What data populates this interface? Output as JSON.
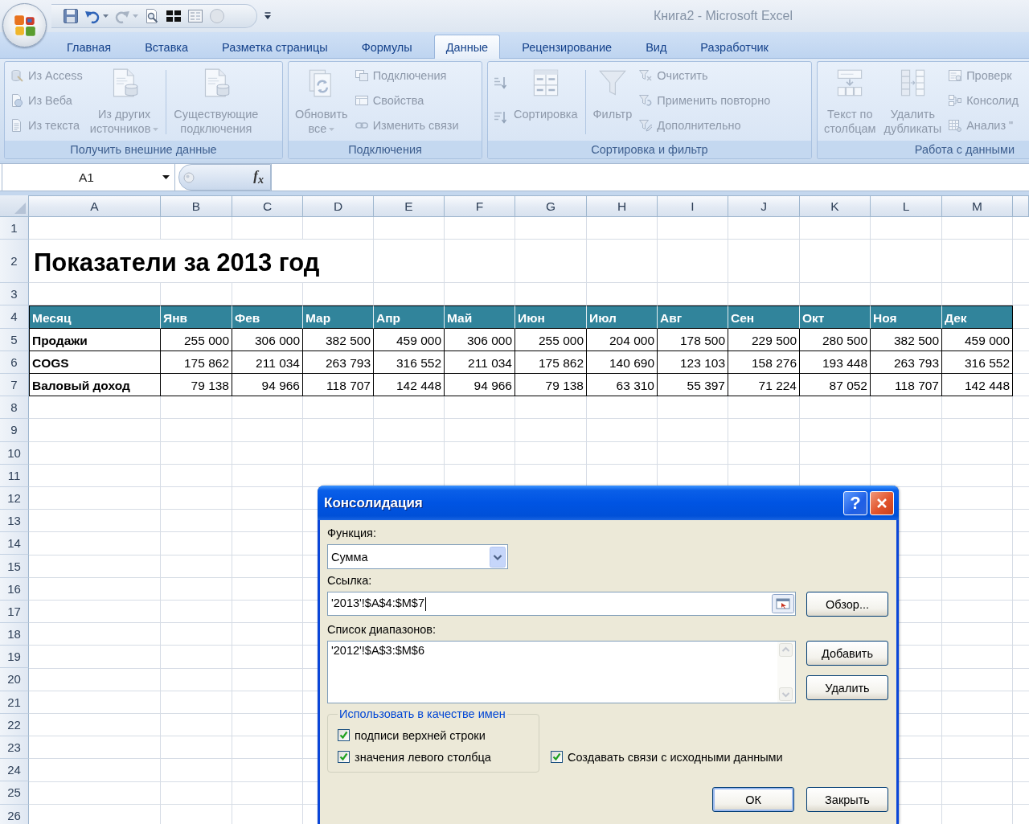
{
  "title_bar": {
    "title": "Книга2 - Microsoft Excel"
  },
  "tabs": [
    {
      "label": "Главная",
      "selected": false
    },
    {
      "label": "Вставка",
      "selected": false
    },
    {
      "label": "Разметка страницы",
      "selected": false
    },
    {
      "label": "Формулы",
      "selected": false
    },
    {
      "label": "Данные",
      "selected": true
    },
    {
      "label": "Рецензирование",
      "selected": false
    },
    {
      "label": "Вид",
      "selected": false
    },
    {
      "label": "Разработчик",
      "selected": false
    }
  ],
  "ribbon": {
    "groups": [
      {
        "label": "Получить внешние данные",
        "columns": [
          {
            "kind": "stack",
            "items": [
              {
                "label": "Из Access",
                "disabled": true
              },
              {
                "label": "Из Веба",
                "disabled": true
              },
              {
                "label": "Из текста",
                "disabled": true
              }
            ]
          },
          {
            "kind": "large",
            "label": "Из других\nисточников",
            "menu": true,
            "disabled": true
          },
          {
            "kind": "separator"
          },
          {
            "kind": "large",
            "label": "Существующие\nподключения",
            "menu": false,
            "disabled": true
          }
        ]
      },
      {
        "label": "Подключения",
        "columns": [
          {
            "kind": "large",
            "label": "Обновить\nвсе",
            "menu": true,
            "disabled": true
          },
          {
            "kind": "stack",
            "items": [
              {
                "label": "Подключения",
                "disabled": true
              },
              {
                "label": "Свойства",
                "disabled": true
              },
              {
                "label": "Изменить связи",
                "disabled": true
              }
            ]
          }
        ]
      },
      {
        "label": "Сортировка и фильтр",
        "columns": [
          {
            "kind": "icon_stack",
            "items": [
              {
                "disabled": true
              },
              {
                "disabled": true
              }
            ]
          },
          {
            "kind": "large",
            "label": "Сортировка",
            "menu": false,
            "disabled": true
          },
          {
            "kind": "separator"
          },
          {
            "kind": "large",
            "label": "Фильтр",
            "menu": false,
            "disabled": true
          },
          {
            "kind": "stack",
            "items": [
              {
                "label": "Очистить",
                "disabled": true
              },
              {
                "label": "Применить повторно",
                "disabled": true
              },
              {
                "label": "Дополнительно",
                "disabled": true
              }
            ]
          }
        ]
      },
      {
        "label": "Работа с данными",
        "columns": [
          {
            "kind": "large",
            "label": "Текст по\nстолбцам",
            "menu": false,
            "disabled": true
          },
          {
            "kind": "large",
            "label": "Удалить\nдубликаты",
            "menu": false,
            "disabled": true
          },
          {
            "kind": "stack",
            "items": [
              {
                "label": "Проверк",
                "disabled": true
              },
              {
                "label": "Консолид",
                "disabled": true
              },
              {
                "label": "Анализ \"",
                "disabled": true
              }
            ]
          }
        ]
      }
    ]
  },
  "formula_bar": {
    "name_box": "A1",
    "function_button": "f$_{x}$"
  },
  "sheet": {
    "columns": [
      "A",
      "B",
      "C",
      "D",
      "E",
      "F",
      "G",
      "H",
      "I",
      "J",
      "K",
      "L",
      "M"
    ],
    "rows": [
      {
        "number": "1",
        "kind": "empty"
      },
      {
        "number": "2",
        "kind": "title",
        "text": "Показатели за 2013 год"
      },
      {
        "number": "3",
        "kind": "empty"
      },
      {
        "number": "4",
        "kind": "header",
        "cells": [
          "Месяц",
          "Янв",
          "Фев",
          "Мар",
          "Апр",
          "Май",
          "Июн",
          "Июл",
          "Авг",
          "Сен",
          "Окт",
          "Ноя",
          "Дек"
        ]
      },
      {
        "number": "5",
        "kind": "data",
        "cells": [
          "Продажи",
          "255 000",
          "306 000",
          "382 500",
          "459 000",
          "306 000",
          "255 000",
          "204 000",
          "178 500",
          "229 500",
          "280 500",
          "382 500",
          "459 000"
        ]
      },
      {
        "number": "6",
        "kind": "data",
        "cells": [
          "COGS",
          "175 862",
          "211 034",
          "263 793",
          "316 552",
          "211 034",
          "175 862",
          "140 690",
          "123 103",
          "158 276",
          "193 448",
          "263 793",
          "316 552"
        ]
      },
      {
        "number": "7",
        "kind": "data",
        "cells": [
          "Валовый доход",
          "79 138",
          "94 966",
          "118 707",
          "142 448",
          "94 966",
          "79 138",
          "63 310",
          "55 397",
          "71 224",
          "87 052",
          "118 707",
          "142 448"
        ]
      },
      {
        "number": "8",
        "kind": "empty"
      },
      {
        "number": "9",
        "kind": "empty"
      },
      {
        "number": "10",
        "kind": "empty"
      },
      {
        "number": "11",
        "kind": "empty"
      },
      {
        "number": "12",
        "kind": "empty"
      },
      {
        "number": "13",
        "kind": "empty"
      },
      {
        "number": "14",
        "kind": "empty"
      },
      {
        "number": "15",
        "kind": "empty"
      },
      {
        "number": "16",
        "kind": "empty"
      },
      {
        "number": "17",
        "kind": "empty"
      },
      {
        "number": "18",
        "kind": "empty"
      },
      {
        "number": "19",
        "kind": "empty"
      },
      {
        "number": "20",
        "kind": "empty"
      },
      {
        "number": "21",
        "kind": "empty"
      },
      {
        "number": "22",
        "kind": "empty"
      },
      {
        "number": "23",
        "kind": "empty"
      },
      {
        "number": "24",
        "kind": "empty"
      },
      {
        "number": "25",
        "kind": "empty"
      },
      {
        "number": "26",
        "kind": "empty"
      }
    ]
  },
  "dialog": {
    "title": "Консолидация",
    "help_button": "?",
    "function_label": "Функция:",
    "function_value": "Сумма",
    "reference_label": "Ссылка:",
    "reference_value": "'2013'!$A$4:$M$7",
    "browse_button": "Обзор...",
    "ranges_label": "Список диапазонов:",
    "ranges": [
      {
        "text": "'2012'!$A$3:$M$6",
        "selected": false
      }
    ],
    "add_button": "Добавить",
    "delete_button": "Удалить",
    "names_group": {
      "legend": "Использовать в качестве имен",
      "options": [
        {
          "label": "подписи верхней строки",
          "checked": true
        },
        {
          "label": "значения левого столбца",
          "checked": true
        }
      ]
    },
    "link_option": {
      "label": "Создавать связи с исходными данными",
      "checked": true
    },
    "buttons": [
      {
        "label": "ОК",
        "default": true
      },
      {
        "label": "Закрыть",
        "default": false
      }
    ]
  }
}
